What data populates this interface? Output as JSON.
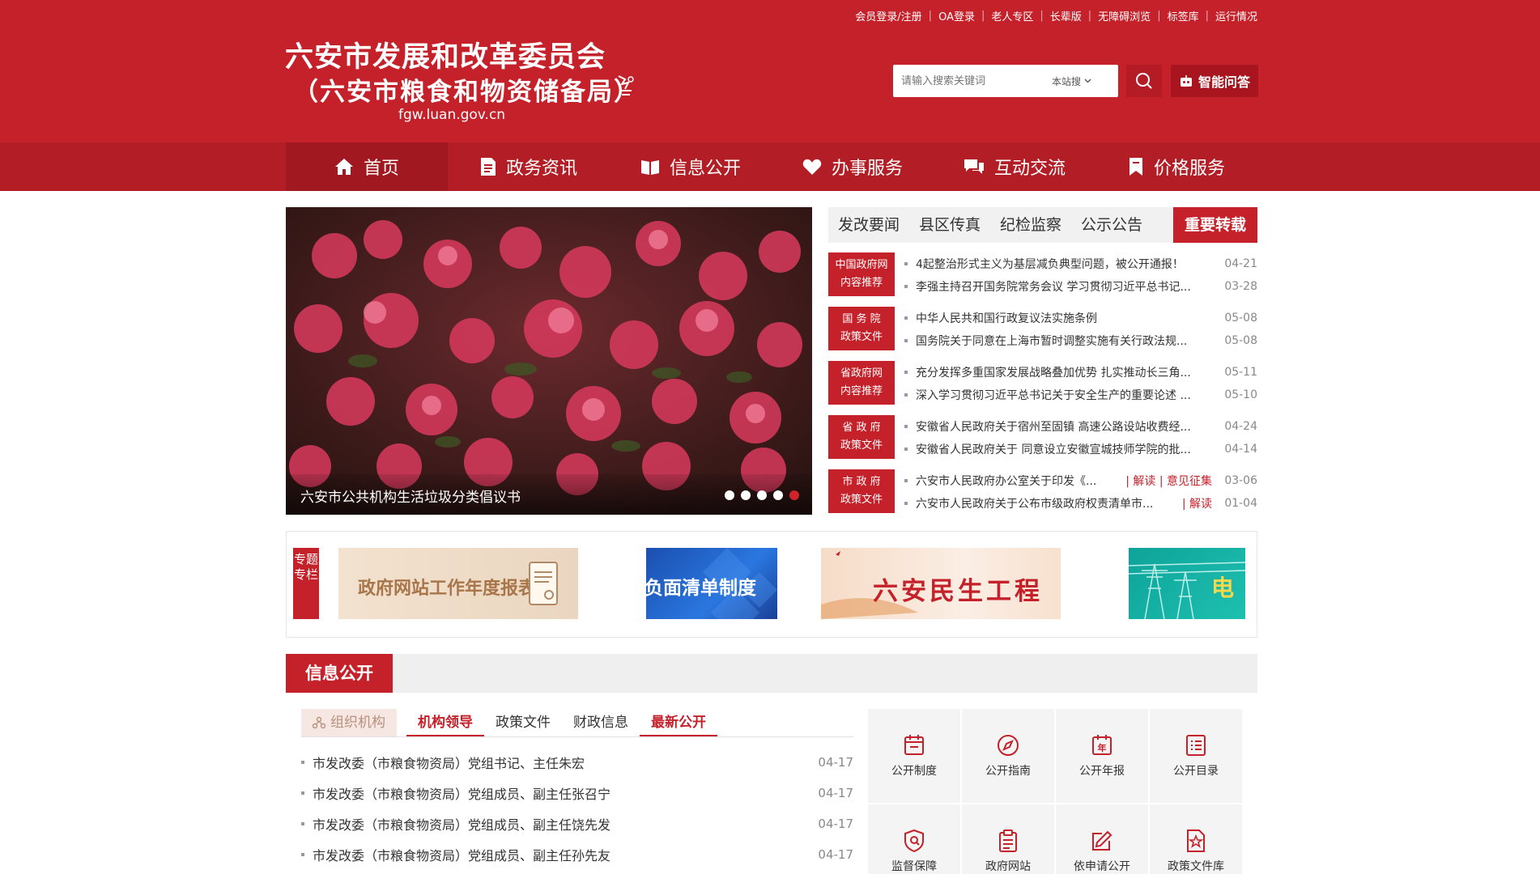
{
  "header": {
    "title_line1": "六安市发展和改革委员会",
    "title_line2": "（六安市粮食和物资储备局）",
    "domain": "fgw.luan.gov.cn",
    "top_links": [
      "会员登录/注册",
      "OA登录",
      "老人专区",
      "长辈版",
      "无障碍浏览",
      "标签库",
      "运行情况"
    ],
    "search_placeholder": "请输入搜索关键词",
    "search_scope": "本站搜",
    "ai_button": "智能问答"
  },
  "nav": {
    "items": [
      {
        "label": "首页",
        "icon": "home-icon"
      },
      {
        "label": "政务资讯",
        "icon": "document-icon"
      },
      {
        "label": "信息公开",
        "icon": "open-book-icon"
      },
      {
        "label": "办事服务",
        "icon": "heart-icon"
      },
      {
        "label": "互动交流",
        "icon": "chat-icon"
      },
      {
        "label": "价格服务",
        "icon": "bookmark-icon"
      }
    ]
  },
  "slider": {
    "caption": "六安市公共机构生活垃圾分类倡议书",
    "dot_count": 5,
    "active_dot": 5
  },
  "news": {
    "tabs": [
      "发改要闻",
      "县区传真",
      "纪检监察",
      "公示公告",
      "重要转载"
    ],
    "active_tab": "重要转载",
    "groups": [
      {
        "badge_line1": "中国政府网",
        "badge_line2": "内容推荐",
        "items": [
          {
            "title": "4起整治形式主义为基层减负典型问题，被公开通报！",
            "date": "04-21"
          },
          {
            "title": "李强主持召开国务院常务会议 学习贯彻习近平总书记...",
            "date": "03-28"
          }
        ]
      },
      {
        "badge_line1": "国 务 院",
        "badge_line2": "政策文件",
        "items": [
          {
            "title": "中华人民共和国行政复议法实施条例",
            "date": "05-08"
          },
          {
            "title": "国务院关于同意在上海市暂时调整实施有关行政法规...",
            "date": "05-08"
          }
        ]
      },
      {
        "badge_line1": "省政府网",
        "badge_line2": "内容推荐",
        "items": [
          {
            "title": "充分发挥多重国家发展战略叠加优势 扎实推动长三角...",
            "date": "05-11"
          },
          {
            "title": "深入学习贯彻习近平总书记关于安全生产的重要论述 ...",
            "date": "05-10"
          }
        ]
      },
      {
        "badge_line1": "省 政 府",
        "badge_line2": "政策文件",
        "items": [
          {
            "title": "安徽省人民政府关于宿州至固镇 高速公路设站收费经...",
            "date": "04-24"
          },
          {
            "title": "安徽省人民政府关于 同意设立安徽宣城技师学院的批...",
            "date": "04-14"
          }
        ]
      },
      {
        "badge_line1": "市 政 府",
        "badge_line2": "政策文件",
        "items": [
          {
            "title": "六安市人民政府办公室关于印发《...",
            "extra": "| 解读 | 意见征集",
            "date": "03-06"
          },
          {
            "title": "六安市人民政府关于公布市级政府权责清单市...",
            "extra": "| 解读",
            "date": "01-04"
          }
        ]
      }
    ]
  },
  "topics": {
    "label": "专题专栏",
    "banners": [
      "政府网站工作年度报表",
      "负面清单制度",
      "六安民生工程",
      "电"
    ]
  },
  "info": {
    "title": "信息公开",
    "subtabs": [
      "组织机构",
      "机构领导",
      "政策文件",
      "财政信息",
      "最新公开"
    ],
    "list": [
      {
        "title": "市发改委（市粮食物资局）党组书记、主任朱宏",
        "date": "04-17"
      },
      {
        "title": "市发改委（市粮食物资局）党组成员、副主任张召宁",
        "date": "04-17"
      },
      {
        "title": "市发改委（市粮食物资局）党组成员、副主任饶先发",
        "date": "04-17"
      },
      {
        "title": "市发改委（市粮食物资局）党组成员、副主任孙先友",
        "date": "04-17"
      }
    ],
    "grid": [
      {
        "label": "公开制度",
        "icon": "calendar-icon"
      },
      {
        "label": "公开指南",
        "icon": "compass-icon"
      },
      {
        "label": "公开年报",
        "icon": "annual-report-icon"
      },
      {
        "label": "公开目录",
        "icon": "list-icon"
      },
      {
        "label": "监督保障",
        "icon": "shield-icon"
      },
      {
        "label": "政府网站",
        "icon": "clipboard-icon"
      },
      {
        "label": "依申请公开",
        "icon": "edit-icon"
      },
      {
        "label": "政策文件库",
        "icon": "file-star-icon"
      }
    ]
  },
  "colors": {
    "brand_red": "#c4212a",
    "nav_red": "#b31d25",
    "nav_active": "#a11820"
  }
}
